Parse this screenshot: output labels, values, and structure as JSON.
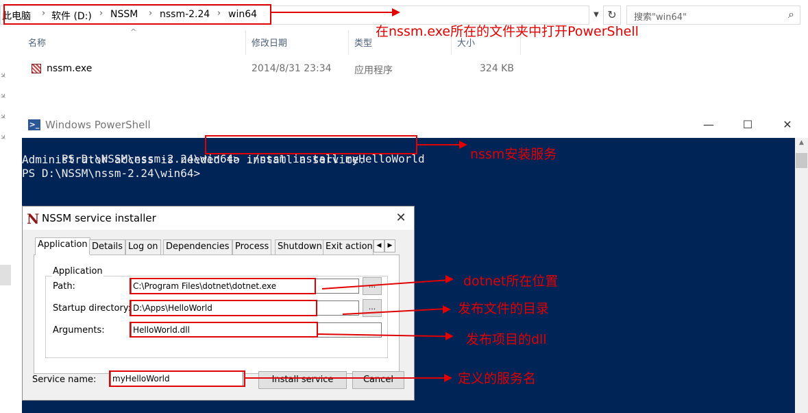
{
  "explorer": {
    "breadcrumb": [
      "此电脑",
      "软件 (D:)",
      "NSSM",
      "nssm-2.24",
      "win64"
    ],
    "search_placeholder": "搜索\"win64\"",
    "columns": {
      "name": "名称",
      "modified": "修改日期",
      "type": "类型",
      "size": "大小"
    },
    "files": [
      {
        "name": "nssm.exe",
        "modified": "2014/8/31 23:34",
        "type": "应用程序",
        "size": "324 KB"
      }
    ]
  },
  "powershell": {
    "title": "Windows PowerShell",
    "prompt1": "PS D:\\NSSM\\nssm-2.24\\win64>",
    "command": "./nssm install myHelloWorld",
    "output": "Administrator access is needed to install a service.",
    "prompt2": "PS D:\\NSSM\\nssm-2.24\\win64>"
  },
  "nssm": {
    "logo": "N",
    "title": "NSSM service installer",
    "tabs": [
      "Application",
      "Details",
      "Log on",
      "Dependencies",
      "Process",
      "Shutdown",
      "Exit actions"
    ],
    "group_label": "Application",
    "path_label": "Path:",
    "path_value": "C:\\Program Files\\dotnet\\dotnet.exe",
    "startup_label": "Startup directory:",
    "startup_value": "D:\\Apps\\HelloWorld",
    "args_label": "Arguments:",
    "args_value": "HelloWorld.dll",
    "service_name_label": "Service name:",
    "service_name_value": "myHelloWorld",
    "browse_label": "...",
    "install_label": "Install service",
    "cancel_label": "Cancel"
  },
  "annotations": {
    "open_powershell": "在nssm.exe所在的文件夹中打开PowerShell",
    "install_service": "nssm安装服务",
    "dotnet_location": "dotnet所在位置",
    "publish_dir": "发布文件的目录",
    "publish_dll": "发布项目的dll",
    "service_name": "定义的服务名"
  },
  "colors": {
    "annotation": "#e00000",
    "powershell_bg": "#012456"
  }
}
